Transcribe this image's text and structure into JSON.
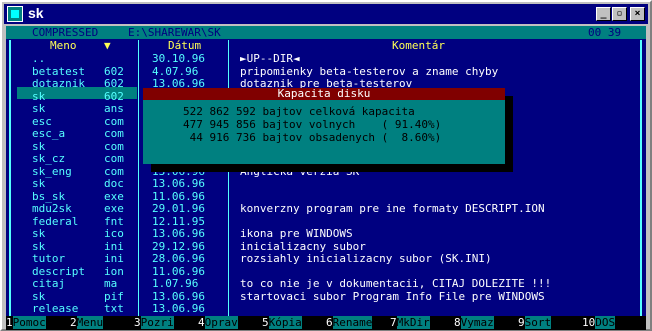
{
  "window": {
    "title": "sk"
  },
  "header": {
    "mode": "COMPRESSED",
    "path": "E:\\SHAREWAR\\SK",
    "time": "00 39"
  },
  "columns": {
    "name": "Meno",
    "sort_arrow": "▼",
    "date": "Dátum",
    "comment": "Komentár"
  },
  "files": [
    {
      "name": "..",
      "ext": "",
      "date": "30.10.96",
      "comment": "►UP--DIR◄"
    },
    {
      "name": "betatest",
      "ext": "602",
      "date": "4.07.96",
      "comment": "pripomienky beta-testerov a zname chyby"
    },
    {
      "name": "dotaznik",
      "ext": "602",
      "date": "13.06.96",
      "comment": "dotaznik pre beta-testerov"
    },
    {
      "name": "sk",
      "ext": "602",
      "date": "",
      "comment": ""
    },
    {
      "name": "sk",
      "ext": "ans",
      "date": "",
      "comment": ""
    },
    {
      "name": "esc",
      "ext": "com",
      "date": "",
      "comment": ""
    },
    {
      "name": "esc_a",
      "ext": "com",
      "date": "",
      "comment": ""
    },
    {
      "name": "sk",
      "ext": "com",
      "date": "",
      "comment": ""
    },
    {
      "name": "sk_cz",
      "ext": "com",
      "date": "",
      "comment": ""
    },
    {
      "name": "sk_eng",
      "ext": "com",
      "date": "13.06.96",
      "comment": "Anglicka verzia SK"
    },
    {
      "name": "sk",
      "ext": "doc",
      "date": "13.06.96",
      "comment": ""
    },
    {
      "name": "bs_sk",
      "ext": "exe",
      "date": "11.06.96",
      "comment": ""
    },
    {
      "name": "mdu2sk",
      "ext": "exe",
      "date": "29.01.96",
      "comment": "konverzny program pre ine formaty DESCRIPT.ION"
    },
    {
      "name": "federal",
      "ext": "fnt",
      "date": "12.11.95",
      "comment": ""
    },
    {
      "name": "sk",
      "ext": "ico",
      "date": "13.06.96",
      "comment": "ikona pre WINDOWS"
    },
    {
      "name": "sk",
      "ext": "ini",
      "date": "29.12.96",
      "comment": "inicializacny subor"
    },
    {
      "name": "tutor",
      "ext": "ini",
      "date": "28.06.96",
      "comment": "rozsiahly inicializacny subor (SK.INI)"
    },
    {
      "name": "descript",
      "ext": "ion",
      "date": "11.06.96",
      "comment": ""
    },
    {
      "name": "citaj",
      "ext": "ma",
      "date": "1.07.96",
      "comment": "to co nie je v dokumentacii, CITAJ DOLEZITE !!!"
    },
    {
      "name": "sk",
      "ext": "pif",
      "date": "13.06.96",
      "comment": "startovaci subor Program Info File pre WINDOWS"
    },
    {
      "name": "release",
      "ext": "txt",
      "date": "13.06.96",
      "comment": ""
    }
  ],
  "dialog": {
    "title": "Kapacita disku",
    "line1": "522 862 592 bajtov celková kapacita",
    "line2": "477 945 856 bajtov volnych    ( 91.40%)",
    "line3": " 44 916 736 bajtov obsadenych (  8.60%)"
  },
  "fkeys": [
    {
      "n": "1",
      "label": "Pomoc"
    },
    {
      "n": "2",
      "label": "Menu"
    },
    {
      "n": "3",
      "label": "Pozri"
    },
    {
      "n": "4",
      "label": "Oprav"
    },
    {
      "n": "5",
      "label": "Kópia"
    },
    {
      "n": "6",
      "label": "Rename"
    },
    {
      "n": "7",
      "label": "MkDir"
    },
    {
      "n": "8",
      "label": "Vymaz"
    },
    {
      "n": "9",
      "label": "Sort"
    },
    {
      "n": "10",
      "label": "DOS"
    }
  ]
}
